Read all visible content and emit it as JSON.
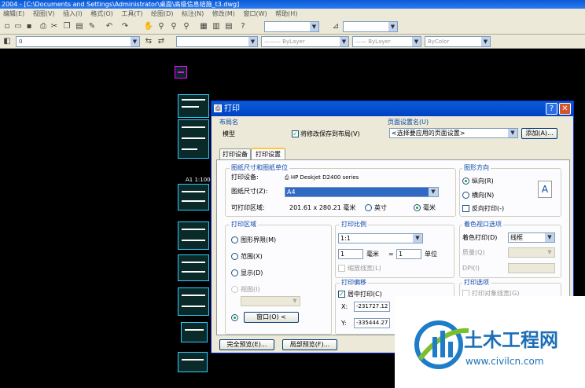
{
  "app": {
    "title": "2004 - [C:\\Documents and Settings\\Administrator\\桌面\\高级信息结施_t3.dwg]",
    "menu": [
      "编辑(E)",
      "视图(V)",
      "插入(I)",
      "格式(O)",
      "工具(T)",
      "绘图(D)",
      "标注(N)",
      "修改(M)",
      "窗口(W)",
      "帮助(H)"
    ],
    "layer_value": "0",
    "linetype": "ByLayer",
    "lineweight": "ByLayer",
    "color": "ByColor",
    "drawing_label": "A1 1:100"
  },
  "dialog": {
    "title": "打印",
    "layout_group": "布局名",
    "layout_name": "模型",
    "save_changes": "将修改保存到布局(V)",
    "page_setup_group": "页面设置名(U)",
    "page_setup_value": "<选择要应用的页面设置>",
    "add_button": "添加(A)...",
    "tabs": [
      "打印设备",
      "打印设置"
    ],
    "paper": {
      "group": "图纸尺寸和图纸单位",
      "device_label": "打印设备:",
      "device_value": "HP Deskjet D2400 series",
      "size_label": "图纸尺寸(Z):",
      "size_value": "A4",
      "area_label": "可打印区域:",
      "area_value": "201.61 x 280.21 毫米",
      "unit_inch": "英寸",
      "unit_mm": "毫米"
    },
    "orientation": {
      "group": "图形方向",
      "portrait": "纵向(R)",
      "landscape": "横向(N)",
      "reverse": "反向打印(-)",
      "icon": "A"
    },
    "plot_area": {
      "group": "打印区域",
      "limits": "图形界限(M)",
      "extents": "范围(X)",
      "display": "显示(D)",
      "view": "视图(I)",
      "window": "窗口(O) <"
    },
    "scale": {
      "group": "打印比例",
      "value": "1:1",
      "mm_value": "1",
      "mm_label": "毫米",
      "equals": "=",
      "unit_value": "1",
      "unit_label": "单位",
      "scale_lineweights": "缩放线宽(L)"
    },
    "offset": {
      "group": "打印偏移",
      "center": "居中打印(C)",
      "x_label": "X:",
      "x_value": "-231727.12",
      "y_label": "Y:",
      "y_value": "-335444.27"
    },
    "shaded": {
      "group": "着色视口选项",
      "shade_label": "着色打印(D)",
      "shade_value": "线框",
      "quality_label": "质量(Q)",
      "dpi_label": "DPI(I)"
    },
    "options": {
      "group": "打印选项",
      "lineweights": "打印对象线宽(G)"
    },
    "full_preview": "完全预览(E)...",
    "partial_preview": "局部预览(F)..."
  },
  "watermark": {
    "brand": "土木工程网",
    "url": "www.civilcn.com"
  }
}
